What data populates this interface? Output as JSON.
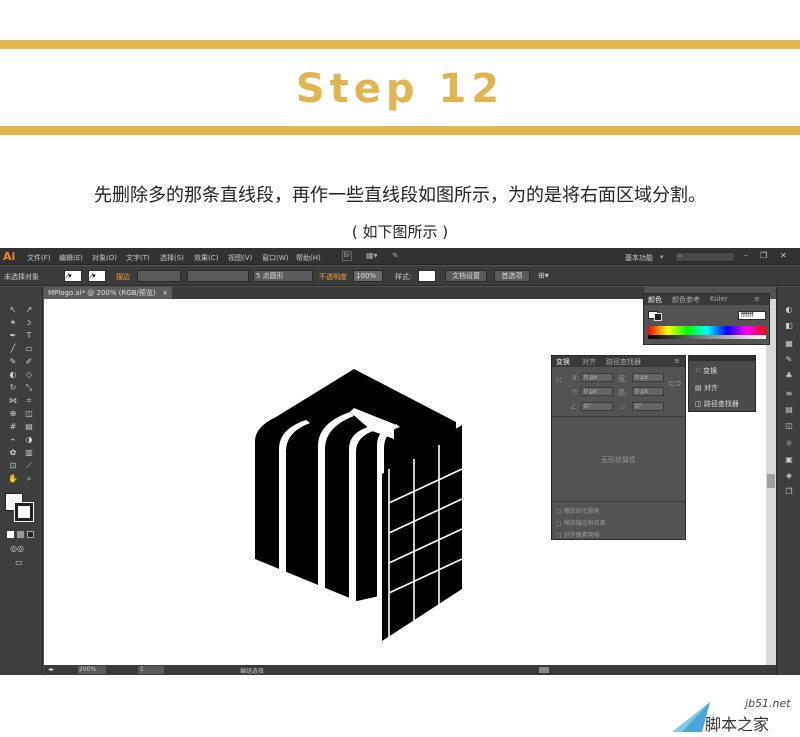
{
  "header": {
    "step_title": "Step 12",
    "description": "先删除多的那条直线段，再作一些直线段如图所示，为的是将右面区域分割。",
    "subtitle": "( 如下图所示 )"
  },
  "app": {
    "logo": "Ai",
    "menu": [
      "文件(F)",
      "编辑(E)",
      "对象(O)",
      "文字(T)",
      "选择(S)",
      "效果(C)",
      "视图(V)",
      "窗口(W)",
      "帮助(H)"
    ],
    "workspace": "基本功能",
    "control_bar": {
      "selection_status": "未选择对象",
      "stroke_label": "描边",
      "brush": "5 点圆形",
      "opacity_label": "不透明度",
      "opacity_value": "100%",
      "style_label": "样式:",
      "doc_setup_button": "文档设置",
      "preferences_button": "首选项"
    },
    "document_tab": "MPlogo.ai* @ 200% (RGB/预览)",
    "color_panel": {
      "tabs": [
        "颜色",
        "颜色参考",
        "Kuler"
      ],
      "hex_value": "ffffff"
    },
    "transform_panel": {
      "tabs": [
        "变换",
        "对齐",
        "路径查找器"
      ],
      "x_label": "X:",
      "y_label": "Y:",
      "w_label": "宽:",
      "h_label": "高:",
      "x_value": "0 px",
      "y_value": "0 px",
      "w_value": "0 px",
      "h_value": "0 px",
      "rotate_value": "0°",
      "shear_value": "0°",
      "empty_message": "无形状属性",
      "checkboxes": [
        "缩放矩形圆角",
        "缩放描边和效果",
        "对齐像素网格"
      ]
    },
    "flyout": {
      "items": [
        "变换",
        "对齐",
        "路径查找器"
      ]
    },
    "status_bar": {
      "zoom": "200%",
      "page": "1",
      "tool_name": "编组选择"
    }
  },
  "watermark": {
    "site": "jb51.net",
    "name": "脚本之家"
  }
}
